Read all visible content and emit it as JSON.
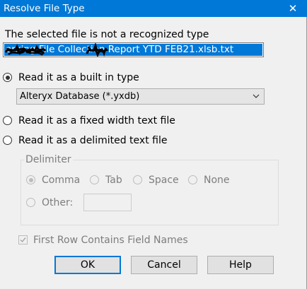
{
  "window": {
    "title": "Resolve File Type",
    "close_glyph": "✕"
  },
  "message": "The selected file is not a recognized type",
  "file_path": "  orking File     Collection Report YTD FEB21.xlsb.txt",
  "options": {
    "built_in": {
      "label": "Read it as a built in type",
      "selected": true
    },
    "built_in_type": "Alteryx Database (*.yxdb)",
    "fixed_width": {
      "label": "Read it as a fixed width text file",
      "selected": false
    },
    "delimited": {
      "label": "Read it as a delimited text file",
      "selected": false
    }
  },
  "delimiter": {
    "legend": "Delimiter",
    "comma": "Comma",
    "tab": "Tab",
    "space": "Space",
    "none": "None",
    "other": "Other:",
    "other_value": "",
    "selected": "Comma"
  },
  "first_row": {
    "label": "First Row Contains Field Names",
    "checked": true
  },
  "buttons": {
    "ok": "OK",
    "cancel": "Cancel",
    "help": "Help"
  },
  "colors": {
    "titlebar": "#0078d7",
    "selection": "#0078d7",
    "dialog_bg": "#f0f0f0",
    "disabled_text": "#7d7d7d"
  },
  "icons": {
    "close": "close-icon",
    "dropdown": "chevron-down-icon",
    "check": "checkmark-icon"
  }
}
